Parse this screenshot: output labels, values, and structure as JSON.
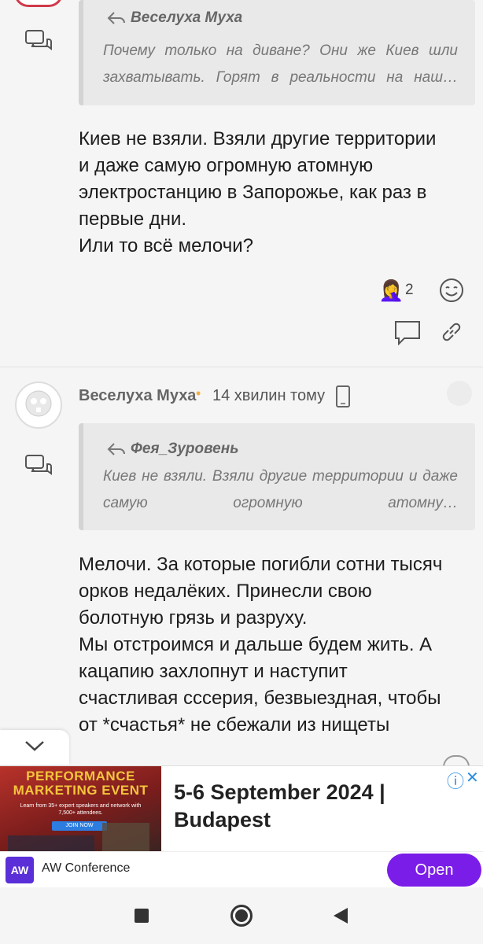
{
  "posts": [
    {
      "quote": {
        "author": "Веселуха Муха",
        "text": "Почему только на диване? Они же Киев шли захватывать. Горят в реальности на наш…"
      },
      "body": "Киев не взяли. Взяли другие территории\nи даже самую огромную атомную\nэлектростанцию в Запорожье, как раз в\nпервые дни.\nИли то всё мелочи?",
      "reactions": {
        "emoji": "🤦‍♀️",
        "count": "2"
      }
    },
    {
      "author": "Веселуха Муха",
      "separator": "•",
      "time": "14 хвилин тому",
      "quote": {
        "author": "Фея_Зуровень",
        "text": "Киев не взяли. Взяли другие территории и даже самую огромную атомну…"
      },
      "body": "Мелочи. За которые погибли сотни тысяч\nорков недалёких. Принесли свою\nболотную грязь и разруху.\nМы отстроимся и дальше будем жить. А\nкацапию захлопнут и наступит\nсчастливая сссерия, безвыездная, чтобы\nот *счастья* не сбежали из нищеты"
    }
  ],
  "ad": {
    "image": {
      "title": "PERFORMANCE MARKETING EVENT",
      "subtitle": "Learn from 35+ expert speakers and network with 7,500+ attendees.",
      "button": "JOIN NOW"
    },
    "headline": "5-6 September 2024 | Budapest",
    "advertiser": "AW Conference",
    "logo_text": "AW",
    "cta": "Open",
    "cta_color": "#7b1de8",
    "info_glyph": "ⓘ",
    "close_glyph": "✕"
  },
  "scroll_down_glyph": "⌄"
}
